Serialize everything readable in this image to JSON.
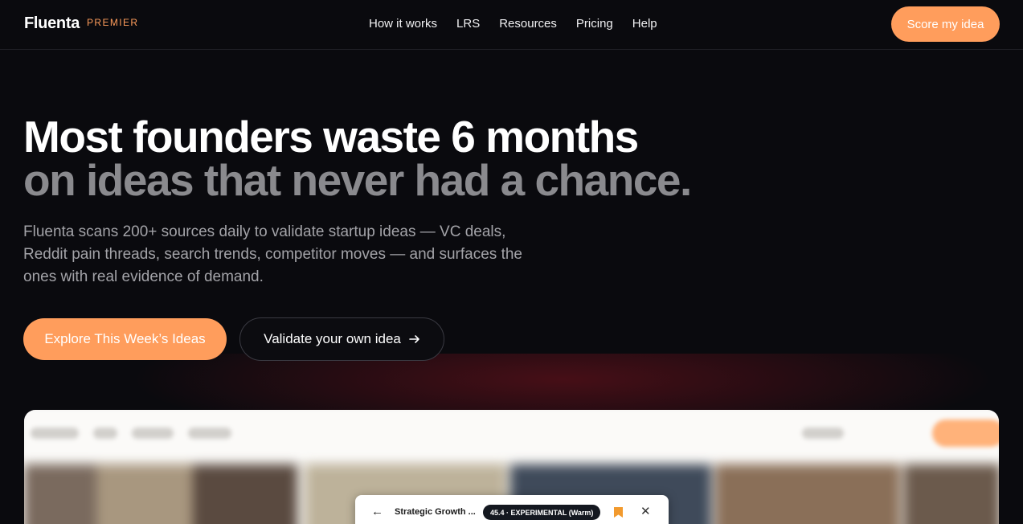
{
  "header": {
    "brand": "Fluenta",
    "tier": "PREMIER",
    "nav": [
      "How it works",
      "LRS",
      "Resources",
      "Pricing",
      "Help"
    ],
    "cta": "Score my idea"
  },
  "hero": {
    "title_line1": "Most founders waste 6 months",
    "title_line2": "on ideas that never had a chance.",
    "subtitle": "Fluenta scans 200+ sources daily to validate startup ideas — VC deals, Reddit pain threads, search trends, competitor moves — and surfaces the ones with real evidence of demand.",
    "primary_button": "Explore This Week’s Ideas",
    "secondary_button": "Validate your own idea"
  },
  "preview": {
    "modal_title": "Strategic Growth ...",
    "modal_badge": "45.4 · EXPERIMENTAL (Warm)"
  },
  "colors": {
    "accent": "#ff9d5c",
    "background": "#0a0a0e",
    "muted_text": "#8a8a8e"
  },
  "icons": {
    "arrow_right": "arrow-right-icon",
    "arrow_left": "arrow-left-icon",
    "bookmark": "bookmark-icon",
    "close": "close-icon"
  }
}
